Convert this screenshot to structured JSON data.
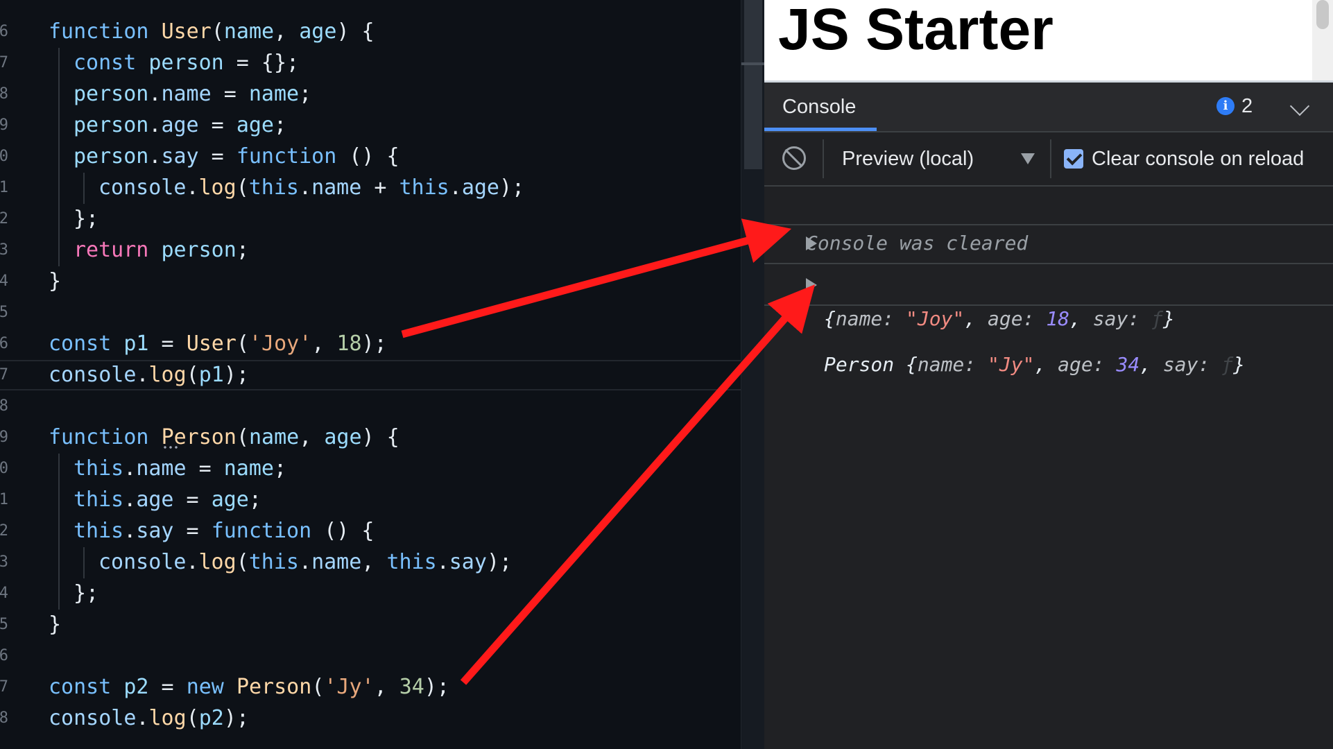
{
  "editor": {
    "lines": [
      {
        "ln": "6",
        "indent": 0,
        "tokens": [
          [
            "kw",
            "function "
          ],
          [
            "nm",
            "User"
          ],
          [
            "pun",
            "("
          ],
          [
            "var",
            "name"
          ],
          [
            "pun",
            ", "
          ],
          [
            "var",
            "age"
          ],
          [
            "pun",
            ") {"
          ]
        ]
      },
      {
        "ln": "7",
        "indent": 1,
        "tokens": [
          [
            "kw",
            "const "
          ],
          [
            "var",
            "person"
          ],
          [
            "pun",
            " = {};"
          ]
        ]
      },
      {
        "ln": "8",
        "indent": 1,
        "tokens": [
          [
            "var",
            "person"
          ],
          [
            "pun",
            "."
          ],
          [
            "prp",
            "name"
          ],
          [
            "pun",
            " = "
          ],
          [
            "var",
            "name"
          ],
          [
            "pun",
            ";"
          ]
        ]
      },
      {
        "ln": "9",
        "indent": 1,
        "tokens": [
          [
            "var",
            "person"
          ],
          [
            "pun",
            "."
          ],
          [
            "prp",
            "age"
          ],
          [
            "pun",
            " = "
          ],
          [
            "var",
            "age"
          ],
          [
            "pun",
            ";"
          ]
        ]
      },
      {
        "ln": "0",
        "indent": 1,
        "tokens": [
          [
            "var",
            "person"
          ],
          [
            "pun",
            "."
          ],
          [
            "prp",
            "say"
          ],
          [
            "pun",
            " = "
          ],
          [
            "kw",
            "function "
          ],
          [
            "pun",
            "() {"
          ]
        ]
      },
      {
        "ln": "1",
        "indent": 2,
        "tokens": [
          [
            "prp",
            "console"
          ],
          [
            "pun",
            "."
          ],
          [
            "nm",
            "log"
          ],
          [
            "pun",
            "("
          ],
          [
            "kw",
            "this"
          ],
          [
            "pun",
            "."
          ],
          [
            "prp",
            "name"
          ],
          [
            "pun",
            " + "
          ],
          [
            "kw",
            "this"
          ],
          [
            "pun",
            "."
          ],
          [
            "prp",
            "age"
          ],
          [
            "pun",
            ");"
          ]
        ]
      },
      {
        "ln": "2",
        "indent": 1,
        "tokens": [
          [
            "pun",
            "};"
          ]
        ]
      },
      {
        "ln": "3",
        "indent": 1,
        "tokens": [
          [
            "ret",
            "return "
          ],
          [
            "var",
            "person"
          ],
          [
            "pun",
            ";"
          ]
        ]
      },
      {
        "ln": "4",
        "indent": 0,
        "tokens": [
          [
            "pun",
            "}"
          ]
        ]
      },
      {
        "ln": "5",
        "indent": 0,
        "tokens": []
      },
      {
        "ln": "6",
        "indent": 0,
        "tokens": [
          [
            "kw",
            "const "
          ],
          [
            "var",
            "p1"
          ],
          [
            "pun",
            " = "
          ],
          [
            "nm",
            "User"
          ],
          [
            "pun",
            "("
          ],
          [
            "str",
            "'Joy'"
          ],
          [
            "pun",
            ", "
          ],
          [
            "num",
            "18"
          ],
          [
            "pun",
            ");"
          ]
        ]
      },
      {
        "ln": "7",
        "indent": 0,
        "tokens": [
          [
            "prp",
            "console"
          ],
          [
            "pun",
            "."
          ],
          [
            "nm",
            "log"
          ],
          [
            "pun",
            "("
          ],
          [
            "var",
            "p1"
          ],
          [
            "pun",
            ");"
          ]
        ],
        "current": true
      },
      {
        "ln": "8",
        "indent": 0,
        "tokens": []
      },
      {
        "ln": "9",
        "indent": 0,
        "tokens": [
          [
            "kw",
            "function "
          ],
          [
            "nm",
            "Person"
          ],
          [
            "pun",
            "("
          ],
          [
            "var",
            "name"
          ],
          [
            "pun",
            ", "
          ],
          [
            "var",
            "age"
          ],
          [
            "pun",
            ") {"
          ]
        ]
      },
      {
        "ln": "0",
        "indent": 1,
        "tokens": [
          [
            "kw",
            "this"
          ],
          [
            "pun",
            "."
          ],
          [
            "prp",
            "name"
          ],
          [
            "pun",
            " = "
          ],
          [
            "var",
            "name"
          ],
          [
            "pun",
            ";"
          ]
        ]
      },
      {
        "ln": "1",
        "indent": 1,
        "tokens": [
          [
            "kw",
            "this"
          ],
          [
            "pun",
            "."
          ],
          [
            "prp",
            "age"
          ],
          [
            "pun",
            " = "
          ],
          [
            "var",
            "age"
          ],
          [
            "pun",
            ";"
          ]
        ]
      },
      {
        "ln": "2",
        "indent": 1,
        "tokens": [
          [
            "kw",
            "this"
          ],
          [
            "pun",
            "."
          ],
          [
            "prp",
            "say"
          ],
          [
            "pun",
            " = "
          ],
          [
            "kw",
            "function "
          ],
          [
            "pun",
            "() {"
          ]
        ]
      },
      {
        "ln": "3",
        "indent": 2,
        "tokens": [
          [
            "prp",
            "console"
          ],
          [
            "pun",
            "."
          ],
          [
            "nm",
            "log"
          ],
          [
            "pun",
            "("
          ],
          [
            "kw",
            "this"
          ],
          [
            "pun",
            "."
          ],
          [
            "prp",
            "name"
          ],
          [
            "pun",
            ", "
          ],
          [
            "kw",
            "this"
          ],
          [
            "pun",
            "."
          ],
          [
            "prp",
            "say"
          ],
          [
            "pun",
            ");"
          ]
        ]
      },
      {
        "ln": "4",
        "indent": 1,
        "tokens": [
          [
            "pun",
            "};"
          ]
        ]
      },
      {
        "ln": "5",
        "indent": 0,
        "tokens": [
          [
            "pun",
            "}"
          ]
        ]
      },
      {
        "ln": "6",
        "indent": 0,
        "tokens": []
      },
      {
        "ln": "7",
        "indent": 0,
        "tokens": [
          [
            "kw",
            "const "
          ],
          [
            "var",
            "p2"
          ],
          [
            "pun",
            " = "
          ],
          [
            "kw",
            "new "
          ],
          [
            "nm",
            "Person"
          ],
          [
            "pun",
            "("
          ],
          [
            "str",
            "'Jy'"
          ],
          [
            "pun",
            ", "
          ],
          [
            "num",
            "34"
          ],
          [
            "pun",
            ");"
          ]
        ]
      },
      {
        "ln": "8",
        "indent": 0,
        "tokens": [
          [
            "prp",
            "console"
          ],
          [
            "pun",
            "."
          ],
          [
            "nm",
            "log"
          ],
          [
            "pun",
            "("
          ],
          [
            "var",
            "p2"
          ],
          [
            "pun",
            ");"
          ]
        ]
      }
    ]
  },
  "preview": {
    "title": "JS Starter"
  },
  "devtools": {
    "tab_label": "Console",
    "info_count": "2",
    "info_icon_glyph": "i",
    "context_label": "Preview (local)",
    "clear_on_reload_label": "Clear console on reload",
    "clear_on_reload_checked": true,
    "cleared_message": "Console was cleared",
    "messages": [
      {
        "tokens": [
          [
            "pun",
            "{"
          ],
          [
            "ckey",
            "name: "
          ],
          [
            "cstr",
            "\"Joy\""
          ],
          [
            "pun",
            ", "
          ],
          [
            "ckey",
            "age: "
          ],
          [
            "cnum",
            "18"
          ],
          [
            "pun",
            ", "
          ],
          [
            "ckey",
            "say: "
          ],
          [
            "fn-glyph",
            "ƒ"
          ],
          [
            "pun",
            "}"
          ]
        ]
      },
      {
        "tokens": [
          [
            "pun",
            "Person {"
          ],
          [
            "ckey",
            "name: "
          ],
          [
            "cstr",
            "\"Jy\""
          ],
          [
            "pun",
            ", "
          ],
          [
            "ckey",
            "age: "
          ],
          [
            "cnum",
            "34"
          ],
          [
            "pun",
            ", "
          ],
          [
            "ckey",
            "say: "
          ],
          [
            "fn-glyph",
            "ƒ"
          ],
          [
            "pun",
            "}"
          ]
        ]
      }
    ]
  },
  "colors": {
    "arrow": "#ff1a1a",
    "editor_bg": "#0d1117",
    "devtools_bg": "#202124",
    "accent": "#4d8ff5"
  }
}
